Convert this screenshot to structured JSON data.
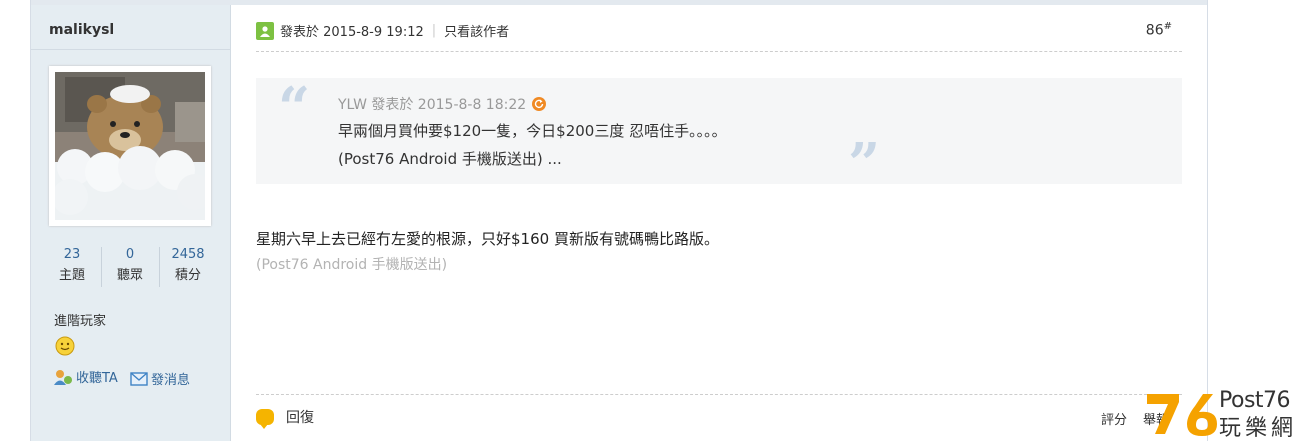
{
  "sidebar": {
    "username": "malikysl",
    "stats": [
      {
        "value": "23",
        "label": "主題"
      },
      {
        "value": "0",
        "label": "聽眾"
      },
      {
        "value": "2458",
        "label": "積分"
      }
    ],
    "rank": "進階玩家",
    "actions": {
      "follow": "收聽TA",
      "message": "發消息"
    }
  },
  "post": {
    "posted_label": "發表於 2015-8-9 19:12",
    "only_author": "只看該作者",
    "floor": "86",
    "floor_sup": "#",
    "quote": {
      "header": "YLW 發表於 2015-8-8 18:22",
      "line1": "早兩個月買仲要$120一隻，今日$200三度 忍唔住手。。。。",
      "line2": "(Post76 Android 手機版送出) ..."
    },
    "body": "星期六早上去已經冇左愛的根源，只好$160 買新版有號碼鴨比路版。",
    "signature": "(Post76 Android 手機版送出)",
    "reply_label": "回復",
    "rate_label": "評分",
    "report_label": "舉報"
  },
  "logo": {
    "brand": "Post76",
    "cn": "玩樂網",
    "num": "76"
  },
  "colors": {
    "link": "#336699",
    "sidebar_bg": "#e5edf2",
    "logo_orange": "#f5a200",
    "quote_bg": "#f5f6f7"
  }
}
